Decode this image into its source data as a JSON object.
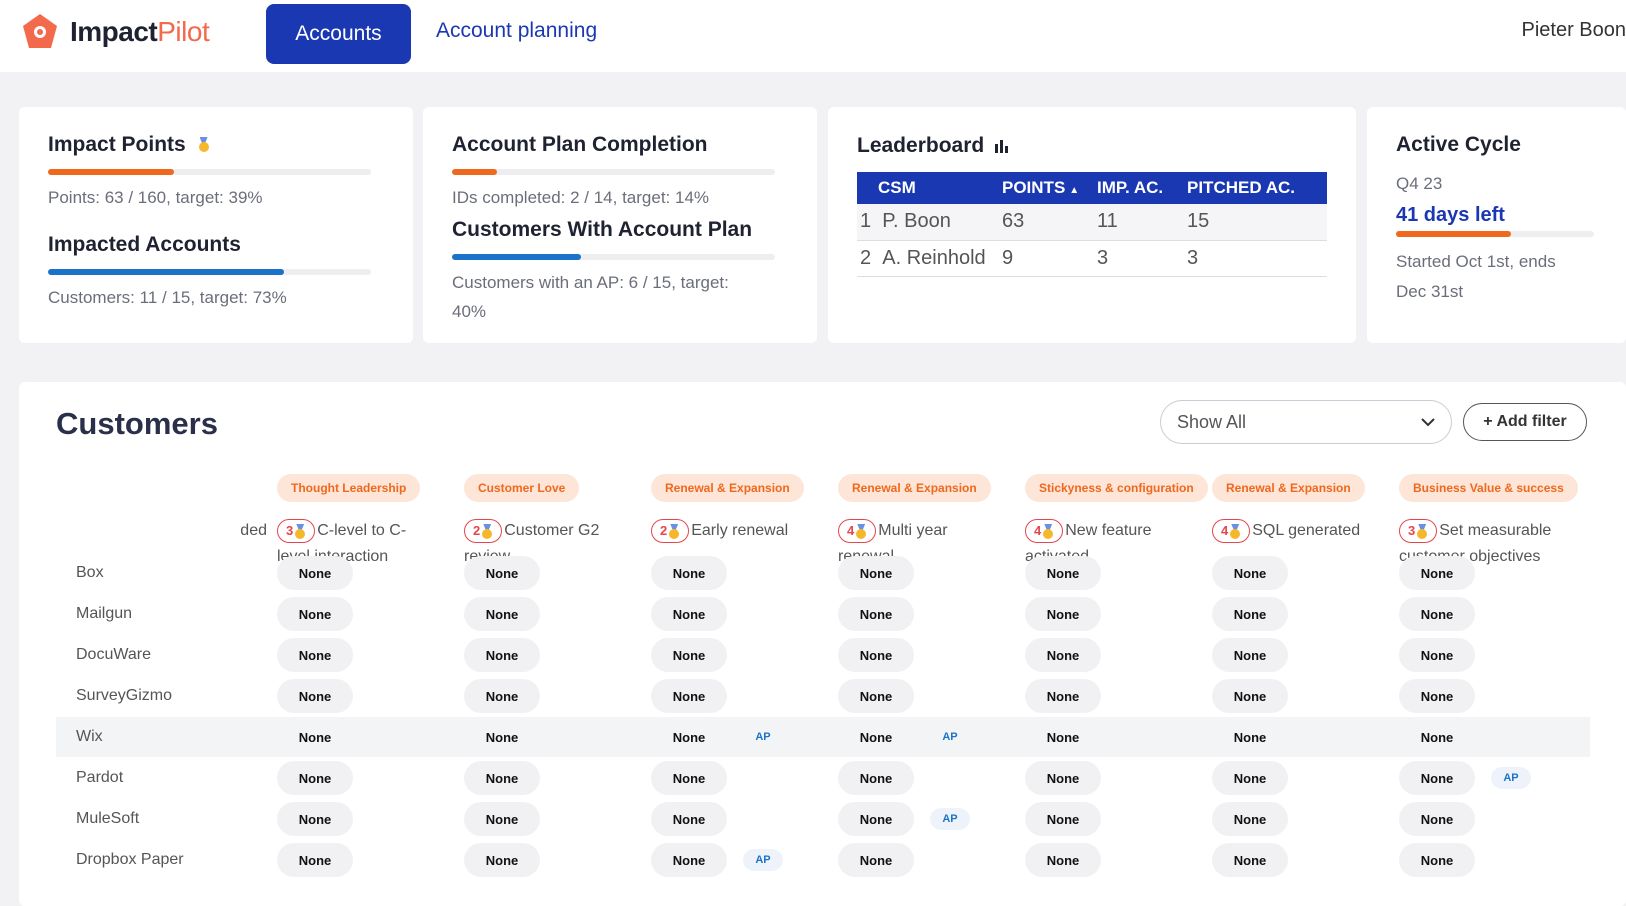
{
  "app": {
    "logo_primary": "Impact",
    "logo_secondary": "Pilot",
    "brand_color": "#f26a4b",
    "accent_color": "#1b38b3"
  },
  "nav": {
    "accounts": "Accounts",
    "account_planning": "Account planning",
    "user": "Pieter Boon"
  },
  "impact_points": {
    "title": "Impact Points",
    "icon": "medal-icon",
    "progress": 0.39,
    "text": "Points: 63 / 160, target: 39%"
  },
  "impacted_accounts": {
    "title": "Impacted Accounts",
    "progress": 0.73,
    "text": "Customers: 11 / 15, target: 73%"
  },
  "plan_completion": {
    "title": "Account Plan Completion",
    "progress": 0.14,
    "text": "IDs completed: 2 / 14, target: 14%"
  },
  "customers_with_plan": {
    "title": "Customers With Account Plan",
    "progress": 0.4,
    "text_line1": "Customers with an AP: 6 / 15, target:",
    "text_line2": "40%"
  },
  "leaderboard": {
    "title": "Leaderboard",
    "icon": "bar-chart-icon",
    "headers": [
      "CSM",
      "POINTS",
      "IMP. AC.",
      "PITCHED AC."
    ],
    "sort_icon": "sort-asc-icon",
    "rows": [
      {
        "rank": "1",
        "csm": "P. Boon",
        "points": "63",
        "imp": "11",
        "pitched": "15"
      },
      {
        "rank": "2",
        "csm": "A. Reinhold",
        "points": "9",
        "imp": "3",
        "pitched": "3"
      }
    ]
  },
  "active_cycle": {
    "title": "Active Cycle",
    "quarter": "Q4 23",
    "days_left": "41 days left",
    "progress": 0.58,
    "line1": "Started Oct 1st, ends",
    "line2": "Dec 31st"
  },
  "customers": {
    "title": "Customers",
    "filter_select": "Show All",
    "add_filter": "+ Add filter",
    "clipped_header": "ded",
    "columns": [
      {
        "tag": "Thought Leadership",
        "points": "3",
        "line1": "C-level to C-",
        "line2": "level interaction"
      },
      {
        "tag": "Customer Love",
        "points": "2",
        "line1": "Customer G2",
        "line2": "review"
      },
      {
        "tag": "Renewal & Expansion",
        "points": "2",
        "line1": "Early renewal",
        "line2": ""
      },
      {
        "tag": "Renewal & Expansion",
        "points": "4",
        "line1": "Multi year",
        "line2": "renewal"
      },
      {
        "tag": "Stickyness & configuration",
        "points": "4",
        "line1": "New feature",
        "line2": "activated"
      },
      {
        "tag": "Renewal & Expansion",
        "points": "4",
        "line1": "SQL generated",
        "line2": ""
      },
      {
        "tag": "Business Value & success",
        "points": "3",
        "line1": "Set measurable",
        "line2": "customer objectives"
      }
    ],
    "value": "None",
    "ap_label": "AP",
    "rows": [
      {
        "name": "Box",
        "ap": []
      },
      {
        "name": "Mailgun",
        "ap": []
      },
      {
        "name": "DocuWare",
        "ap": []
      },
      {
        "name": "SurveyGizmo",
        "ap": []
      },
      {
        "name": "Wix",
        "ap": [
          2,
          3
        ],
        "highlighted": true
      },
      {
        "name": "Pardot",
        "ap": [
          6
        ]
      },
      {
        "name": "MuleSoft",
        "ap": [
          3
        ]
      },
      {
        "name": "Dropbox Paper",
        "ap": [
          2
        ]
      }
    ]
  }
}
